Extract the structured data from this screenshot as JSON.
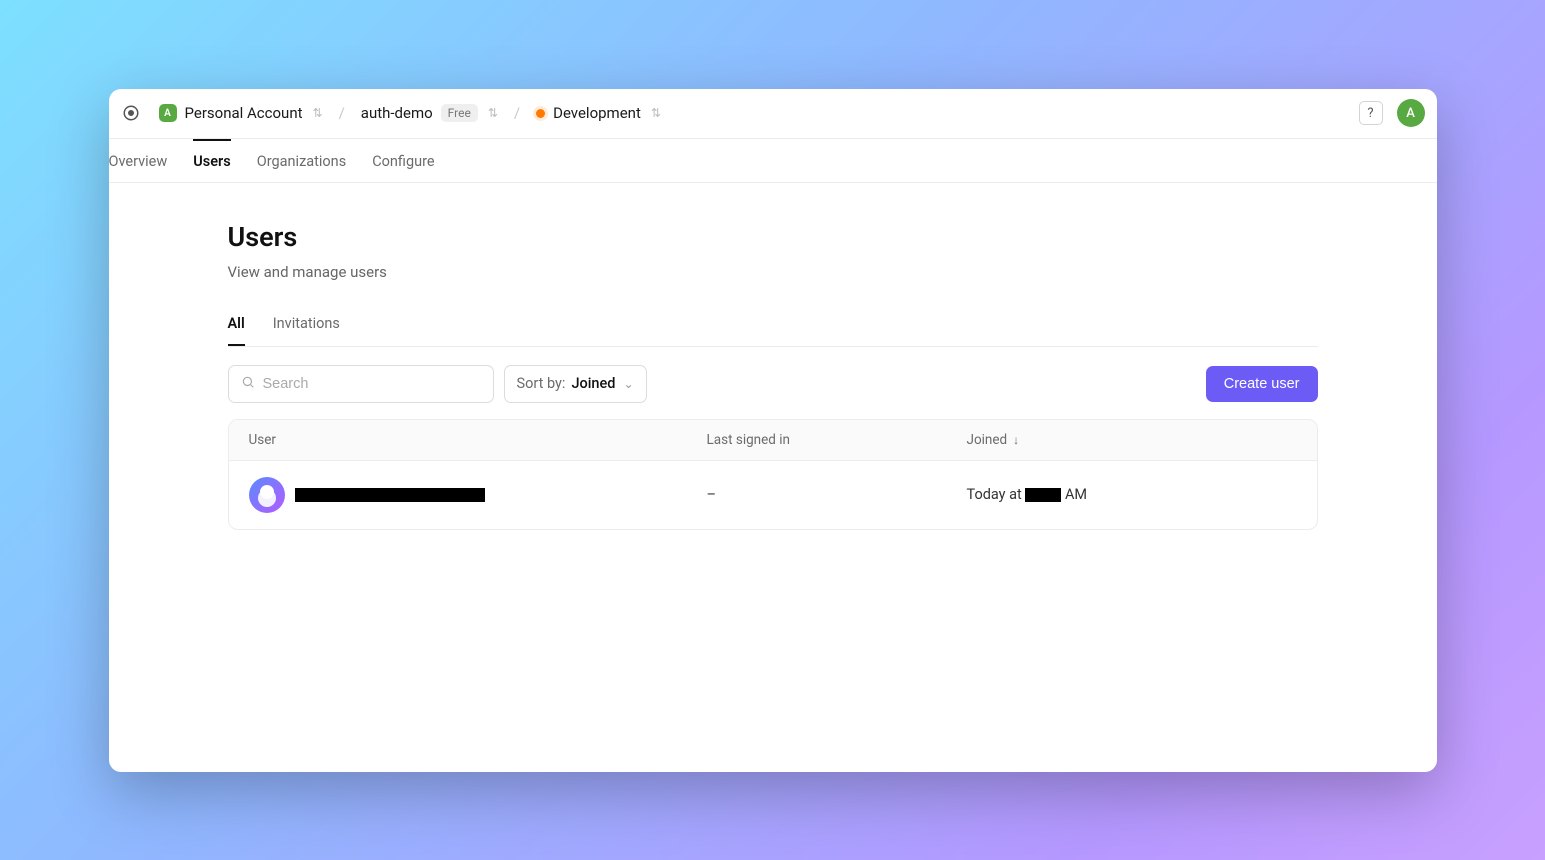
{
  "breadcrumb": {
    "account": {
      "label": "Personal Account",
      "badge": "A"
    },
    "project": {
      "label": "auth-demo",
      "plan": "Free"
    },
    "env": {
      "label": "Development"
    }
  },
  "nav": {
    "tabs": [
      {
        "label": "Overview"
      },
      {
        "label": "Users"
      },
      {
        "label": "Organizations"
      },
      {
        "label": "Configure"
      }
    ]
  },
  "topbar": {
    "avatar_initial": "A"
  },
  "page": {
    "title": "Users",
    "subtitle": "View and manage users"
  },
  "subtabs": [
    {
      "label": "All"
    },
    {
      "label": "Invitations"
    }
  ],
  "toolbar": {
    "search_placeholder": "Search",
    "sort_label": "Sort by:",
    "sort_value": "Joined",
    "create_label": "Create user"
  },
  "table": {
    "headers": {
      "user": "User",
      "last_signed_in": "Last signed in",
      "joined": "Joined"
    },
    "rows": [
      {
        "last_signed_in": "–",
        "joined_prefix": "Today at ",
        "joined_suffix": " AM"
      }
    ]
  }
}
